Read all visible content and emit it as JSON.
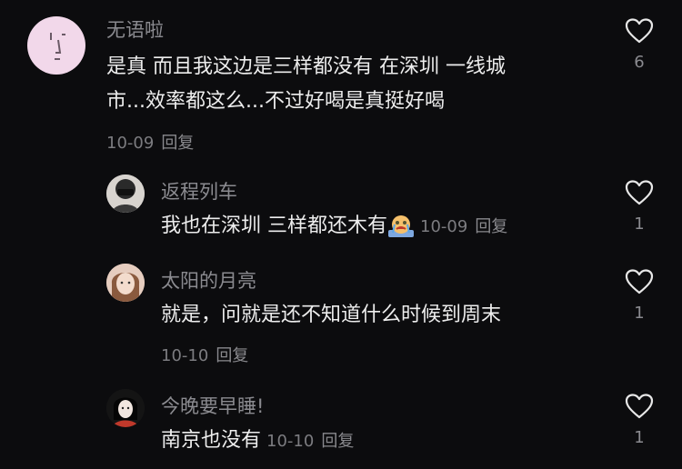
{
  "comments": [
    {
      "username": "无语啦",
      "text_line1": "是真 而且我这边是三样都没有 在深圳 一线城",
      "text_line2": "市...效率都这么...不过好喝是真挺好喝",
      "date": "10-09",
      "reply_label": "回复",
      "likes": "6",
      "avatar_color": "#f2d8ea"
    },
    {
      "username": "返程列车",
      "text": "我也在深圳 三样都还木有",
      "emoji_name": "crying-emoji",
      "date": "10-09",
      "reply_label": "回复",
      "likes": "1"
    },
    {
      "username": "太阳的月亮",
      "text": "就是，问就是还不知道什么时候到周末",
      "date": "10-10",
      "reply_label": "回复",
      "likes": "1"
    },
    {
      "username": "今晚要早睡!",
      "text": "南京也没有",
      "date": "10-10",
      "reply_label": "回复",
      "likes": "1"
    }
  ],
  "colors": {
    "background": "#0c0c0e",
    "text_primary": "#ededed",
    "text_secondary": "#8b8b90",
    "heart_outline": "#e8e8e8"
  },
  "icons": {
    "like": "heart-outline-icon"
  }
}
